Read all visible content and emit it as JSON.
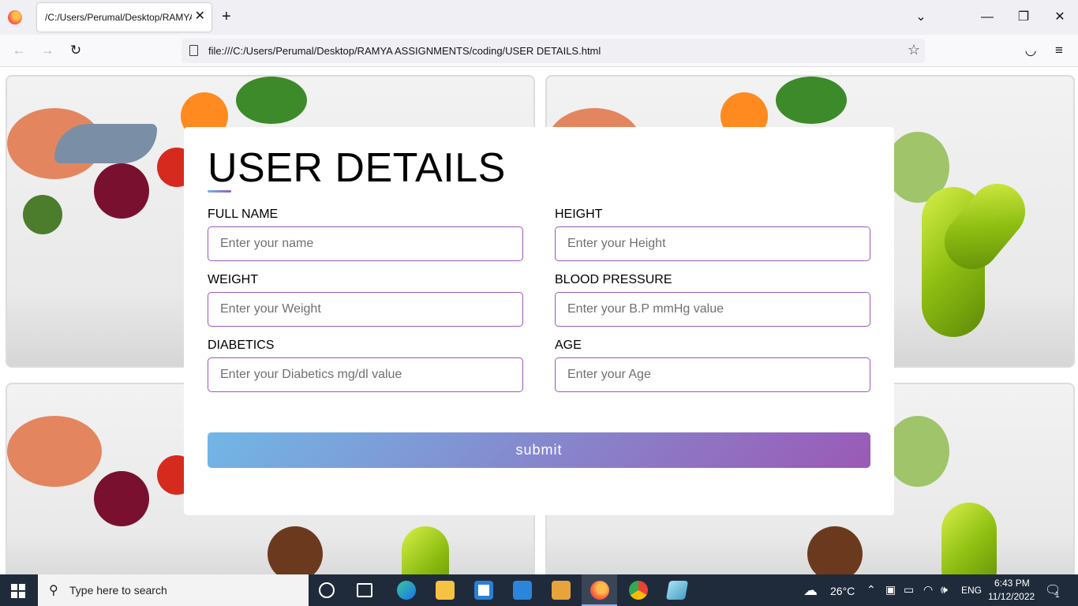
{
  "browser": {
    "tab_title": "/C:/Users/Perumal/Desktop/RAMYA",
    "url": "file:///C:/Users/Perumal/Desktop/RAMYA ASSIGNMENTS/coding/USER DETAILS.html"
  },
  "form": {
    "title": "USER DETAILS",
    "fields": [
      {
        "label": "FULL NAME",
        "placeholder": "Enter your name",
        "value": ""
      },
      {
        "label": "HEIGHT",
        "placeholder": "Enter your Height",
        "value": ""
      },
      {
        "label": "WEIGHT",
        "placeholder": "Enter your Weight",
        "value": ""
      },
      {
        "label": "BLOOD PRESSURE",
        "placeholder": "Enter your B.P mmHg value",
        "value": ""
      },
      {
        "label": "DIABETICS",
        "placeholder": "Enter your Diabetics mg/dl value",
        "value": ""
      },
      {
        "label": "AGE",
        "placeholder": "Enter your Age",
        "value": ""
      }
    ],
    "submit_label": "submit"
  },
  "taskbar": {
    "search_placeholder": "Type here to search",
    "weather": "26°C",
    "language": "ENG",
    "time": "6:43 PM",
    "date": "11/12/2022",
    "notification_count": "1"
  },
  "colors": {
    "accent_start": "#71b7e6",
    "accent_end": "#9b59b6",
    "taskbar": "#1f2b3b"
  }
}
